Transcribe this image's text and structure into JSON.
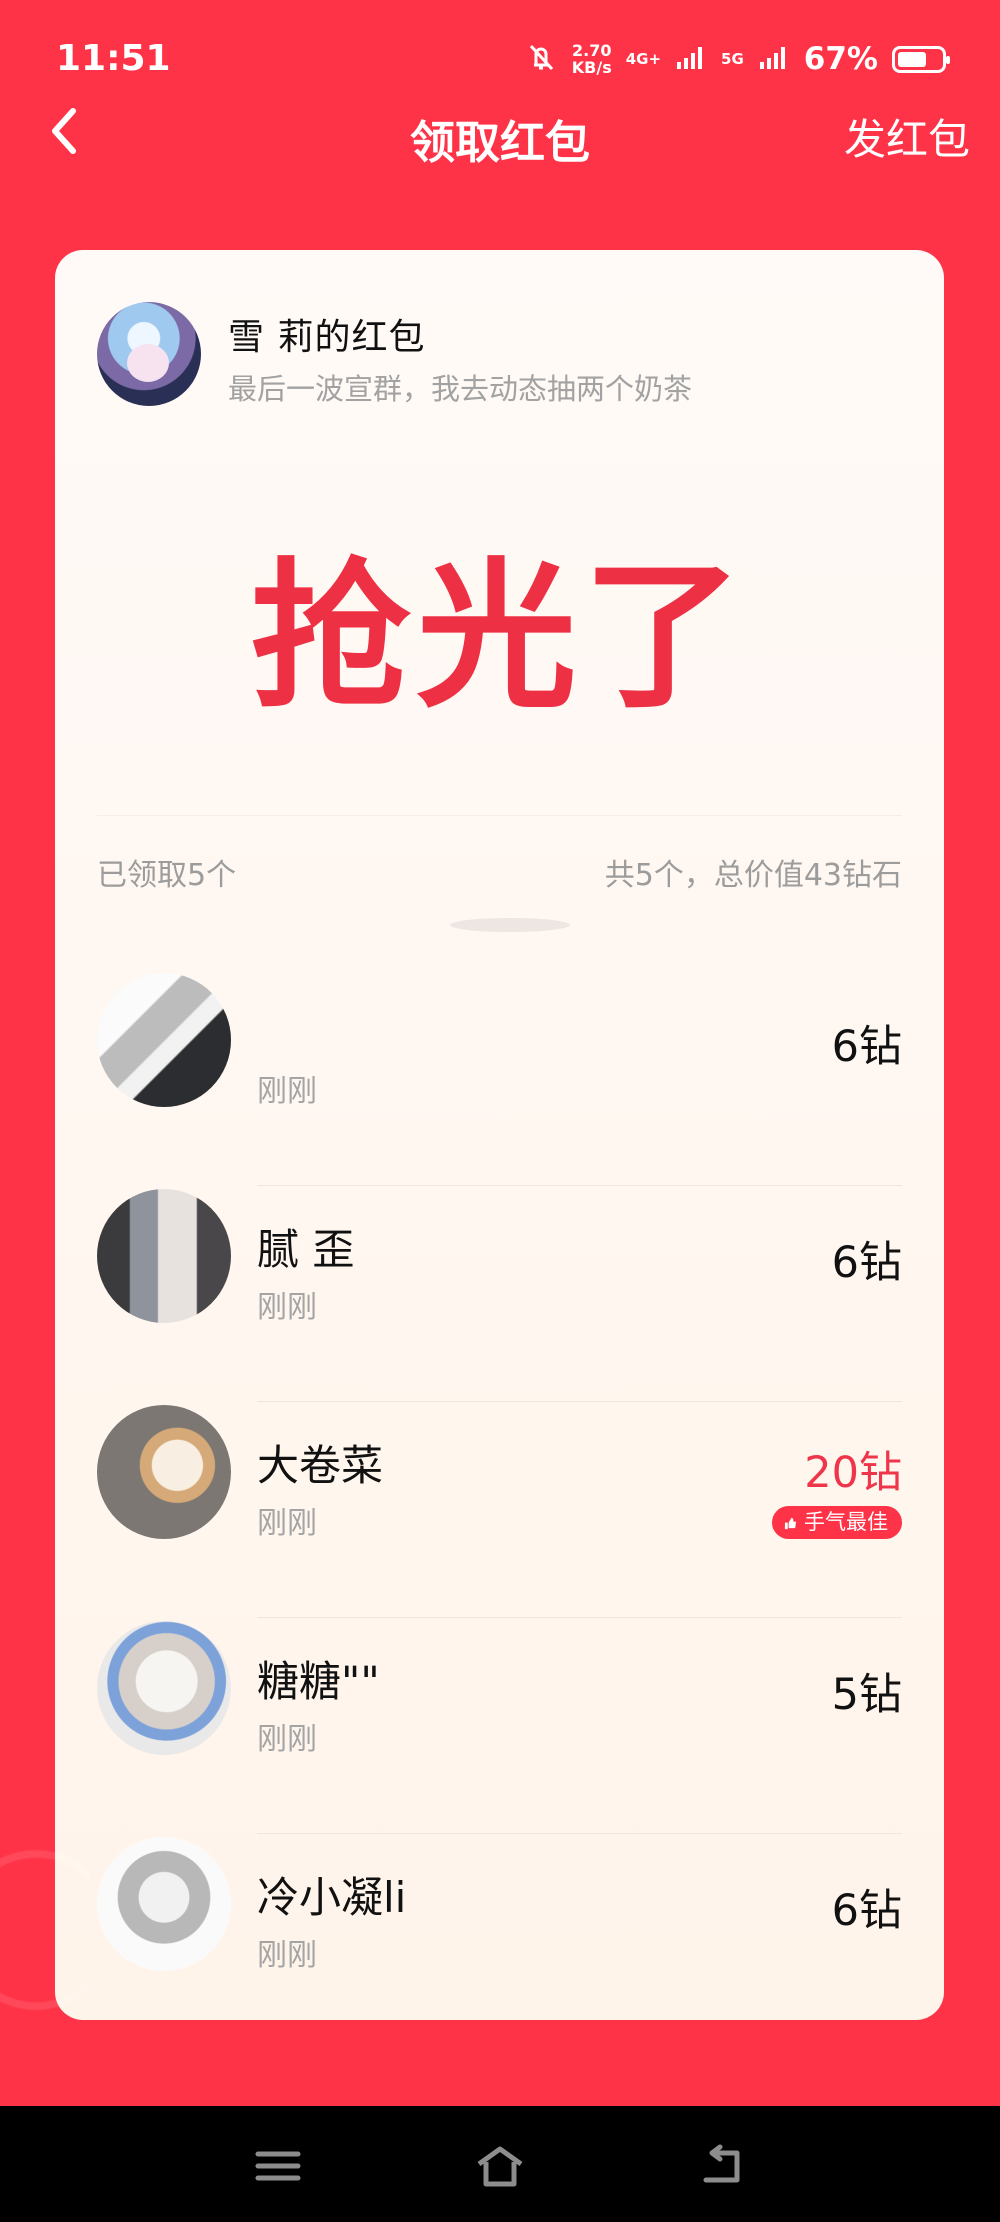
{
  "status_bar": {
    "time": "11:51",
    "speed_value": "2.70",
    "speed_unit": "KB/s",
    "network_4g": "4G+",
    "network_5g": "5G",
    "battery": "67%",
    "battery_level": 0.67
  },
  "header": {
    "title": "领取红包",
    "send_label": "发红包"
  },
  "sender": {
    "name": "雪 莉的红包",
    "message": "最后一波宣群，我去动态抽两个奶茶"
  },
  "status_text": "抢光了",
  "summary": {
    "claimed": "已领取5个",
    "total": "共5个，总价值43钻石"
  },
  "claims": [
    {
      "name": "",
      "time": "刚刚",
      "amount": "6钻"
    },
    {
      "name": "腻 歪",
      "time": "刚刚",
      "amount": "6钻"
    },
    {
      "name": "大卷菜",
      "time": "刚刚",
      "amount": "20钻",
      "badge": "手气最佳"
    },
    {
      "name": "糖糖\"\"",
      "time": "刚刚",
      "amount": "5钻"
    },
    {
      "name": "冷小凝li",
      "time": "刚刚",
      "amount": "6钻"
    }
  ],
  "colors": {
    "primary": "#ff3347",
    "accent": "#ef354a",
    "card": "#fff8f1"
  },
  "icons": [
    "back-icon",
    "mute-icon",
    "signal-icon",
    "battery-icon",
    "menu-icon",
    "home-icon",
    "return-icon",
    "thumb-up-icon"
  ]
}
